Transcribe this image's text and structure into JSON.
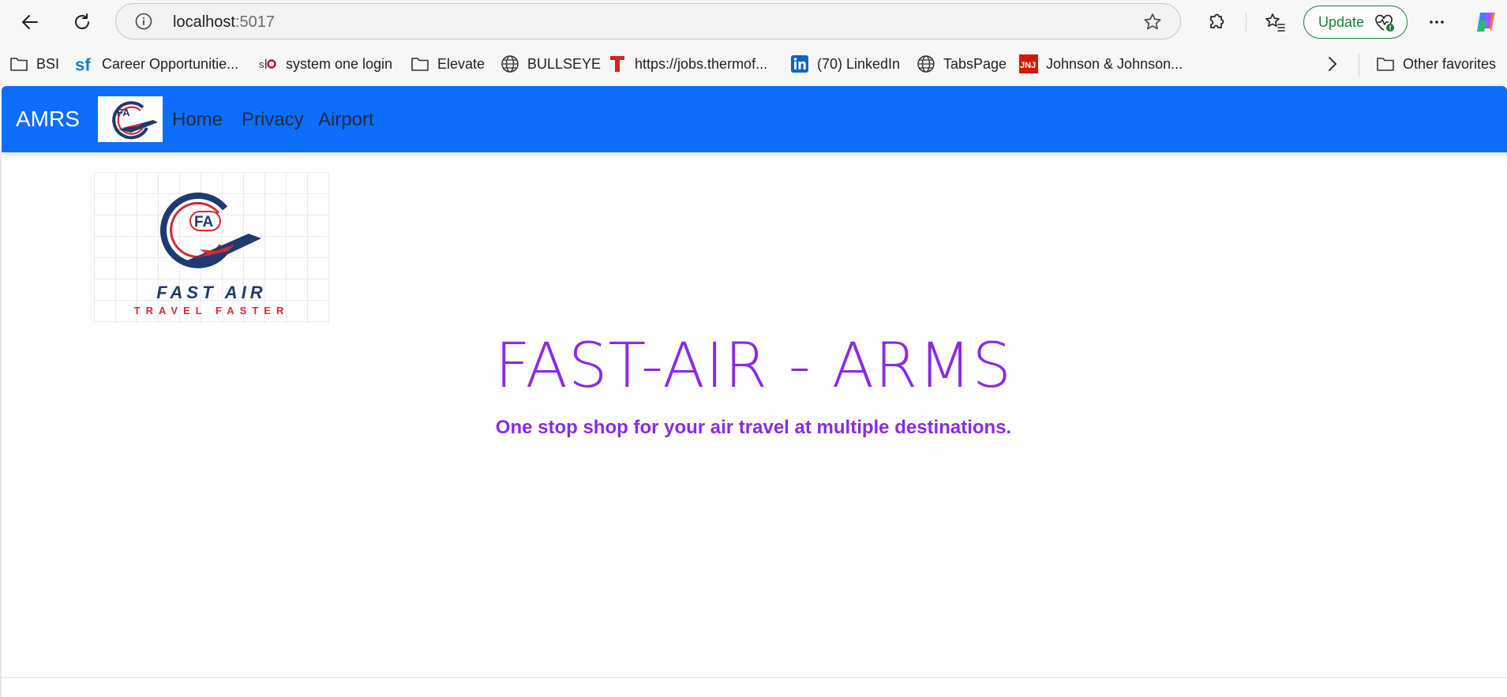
{
  "browser": {
    "address": {
      "host": "localhost",
      "port": ":5017"
    },
    "update_label": "Update",
    "icons": {
      "back": "back-arrow-icon",
      "refresh": "refresh-icon",
      "info": "info-icon",
      "star": "star-icon",
      "extensions": "puzzle-icon",
      "favorites": "favorites-icon",
      "heartbeat": "heartbeat-icon",
      "more": "more-icon",
      "copilot": "copilot-icon"
    },
    "favorites": [
      {
        "label": "BSI",
        "icon": "folder-icon"
      },
      {
        "label": "Career Opportunitie...",
        "icon": "sf-icon"
      },
      {
        "label": "system one login",
        "icon": "so-icon"
      },
      {
        "label": "Elevate",
        "icon": "folder-icon"
      },
      {
        "label": "BULLSEYE",
        "icon": "globe-icon"
      },
      {
        "label": "https://jobs.thermof...",
        "icon": "t-icon"
      },
      {
        "label": "(70) LinkedIn",
        "icon": "linkedin-icon"
      },
      {
        "label": "TabsPage",
        "icon": "globe-icon"
      },
      {
        "label": "Johnson & Johnson...",
        "icon": "jnj-icon"
      }
    ],
    "other_favorites": "Other favorites",
    "colors": {
      "update_green": "#1e7a3a"
    }
  },
  "site": {
    "brand": "AMRS",
    "nav": [
      {
        "label": "Home"
      },
      {
        "label": "Privacy"
      },
      {
        "label": "Airport"
      }
    ],
    "logo": {
      "initials": "FA",
      "name": "FAST AIR",
      "tagline": "TRAVEL FASTER"
    },
    "hero": {
      "title": "FAST-AIR - ARMS",
      "subtitle": "One stop shop for your air travel at multiple destinations."
    },
    "colors": {
      "navbar": "#0d6efd",
      "hero_text": "#8a2be2",
      "logo_navy": "#1e3a6e",
      "logo_red": "#d62839"
    }
  }
}
